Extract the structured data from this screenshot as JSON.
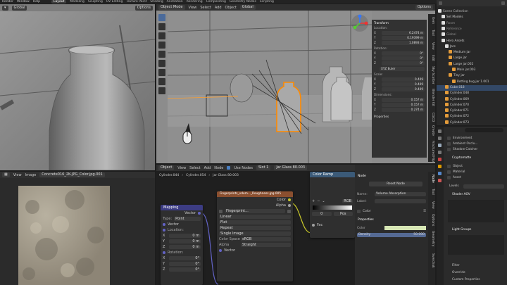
{
  "menu": {
    "items": [
      "Render",
      "Window",
      "Help"
    ],
    "workspace_tabs": [
      "Layout",
      "Modeling",
      "Sculpting",
      "UV Editing",
      "Texture Paint",
      "Shading",
      "Animation",
      "Rendering",
      "Compositing",
      "Geometry Nodes",
      "Scripting"
    ],
    "active_tab": "Layout"
  },
  "left_viewport": {
    "orientation": "Global",
    "options_label": "Options"
  },
  "main_viewport": {
    "mode": "Object Mode",
    "menus": [
      "View",
      "Select",
      "Add",
      "Object"
    ],
    "orientation": "Global",
    "selection_info": "Cylinder.044",
    "options_label": "Options",
    "sidebar_tabs": [
      "Item",
      "Tool",
      "View",
      "Edit",
      "Sky Scatter",
      "Blender Kit",
      "CGCD",
      "Create",
      "Fractured",
      "Flip"
    ]
  },
  "transform": {
    "title": "Transform",
    "location_label": "Location:",
    "location": [
      {
        "axis": "X",
        "value": "6.2474 m"
      },
      {
        "axis": "Y",
        "value": "0.19399 m"
      },
      {
        "axis": "Z",
        "value": "1.0893 m"
      }
    ],
    "rotation_label": "Rotation:",
    "rotation": [
      {
        "axis": "X",
        "value": "0°"
      },
      {
        "axis": "Y",
        "value": "0°"
      },
      {
        "axis": "Z",
        "value": "0°"
      }
    ],
    "rotation_mode": "XYZ Euler",
    "scale_label": "Scale:",
    "scale": [
      {
        "axis": "X",
        "value": "0.409"
      },
      {
        "axis": "Y",
        "value": "0.409"
      },
      {
        "axis": "Z",
        "value": "0.409"
      }
    ],
    "dimensions_label": "Dimensions:",
    "dimensions": [
      {
        "axis": "X",
        "value": "0.157 m"
      },
      {
        "axis": "Y",
        "value": "0.157 m"
      },
      {
        "axis": "Z",
        "value": "0.274 m"
      }
    ],
    "properties_label": "Properties"
  },
  "image_editor": {
    "menus": [
      "View",
      "Image"
    ],
    "image_name": "Concrete016_2K-JPG_Color.jpg.001"
  },
  "node_editor": {
    "type": "Object",
    "menus": [
      "View",
      "Select",
      "Add",
      "Node"
    ],
    "use_nodes_label": "Use Nodes",
    "slot": "Slot 1",
    "material": "Jar Glass 80.003",
    "breadcrumb": [
      "Cylinder.044",
      "Cylinder.054",
      "Jar Glass 80.003"
    ],
    "mapping": {
      "title": "Mapping",
      "output": "Vector",
      "type_label": "Type:",
      "type_value": "Point",
      "input_vector": "Vector",
      "location_label": "Location:",
      "location": [
        {
          "axis": "X",
          "value": "0 m"
        },
        {
          "axis": "Y",
          "value": "0 m"
        },
        {
          "axis": "Z",
          "value": "0 m"
        }
      ],
      "rotation_label": "Rotation:",
      "rotation": [
        {
          "axis": "X",
          "value": "0°"
        },
        {
          "axis": "Y",
          "value": "0°"
        },
        {
          "axis": "Z",
          "value": "0°"
        }
      ]
    },
    "image_texture": {
      "title": "Fingerprints_vdem..._Roughness.jpg.005",
      "outputs": [
        "Color",
        "Alpha"
      ],
      "image_field": "Fingerprint...",
      "interpolation": "Linear",
      "projection": "Flat",
      "extension": "Repeat",
      "source": "Single Image",
      "color_space_label": "Color Space",
      "color_space": "sRGB",
      "alpha_label": "Alpha",
      "alpha": "Straight",
      "input_vector": "Vector"
    },
    "color_ramp": {
      "title": "Color Ramp",
      "mode": "RGB",
      "pos_value": "0",
      "pos_label": "Pos",
      "input": "Fac"
    }
  },
  "node_sidebar": {
    "section_title": "Node",
    "reset_label": "Reset Node",
    "name_label": "Name:",
    "name_value": "Volume Absorption",
    "label_label": "Label:",
    "color_label": "Color",
    "properties_title": "Properties",
    "color_prop_label": "Color",
    "color_swatch": "#d6e6b4",
    "density_label": "Density",
    "density_value": "50.000",
    "tabs": [
      "Node",
      "Tool",
      "View",
      "Options",
      "Geometry",
      "Sverchok"
    ]
  },
  "outliner": {
    "items": [
      {
        "name": "Scene Collection",
        "indent": 0,
        "color": "#bbbbbb"
      },
      {
        "name": "Set Models",
        "indent": 1,
        "color": "#cccccc"
      },
      {
        "name": "Room",
        "indent": 1,
        "color": "#8a8a8a"
      },
      {
        "name": "Reference",
        "indent": 1,
        "color": "#8a8a8a"
      },
      {
        "name": "Global",
        "indent": 1,
        "color": "#8a8a8a"
      },
      {
        "name": "Hero Assets",
        "indent": 1,
        "color": "#cccccc"
      },
      {
        "name": "Jars",
        "indent": 2,
        "color": "#cccccc"
      },
      {
        "name": "Medium jar",
        "indent": 3,
        "color": "#cccccc"
      },
      {
        "name": "Large jar",
        "indent": 3,
        "color": "#cccccc"
      },
      {
        "name": "Large jar.002",
        "indent": 3,
        "color": "#cccccc"
      },
      {
        "name": "Main jar.003",
        "indent": 4,
        "color": "#cccccc"
      },
      {
        "name": "Tiny jar",
        "indent": 3,
        "color": "#cccccc"
      },
      {
        "name": "Rotting bug jar 1.001",
        "indent": 4,
        "color": "#cccccc"
      },
      {
        "name": "Cube.018",
        "indent": 2,
        "color": "#cccccc"
      },
      {
        "name": "Cylinder.048",
        "indent": 2,
        "color": "#cccccc"
      },
      {
        "name": "Cylinder.069",
        "indent": 2,
        "color": "#cccccc"
      },
      {
        "name": "Cylinder.070",
        "indent": 2,
        "color": "#cccccc"
      },
      {
        "name": "Cylinder.071",
        "indent": 2,
        "color": "#cccccc"
      },
      {
        "name": "Cylinder.072",
        "indent": 2,
        "color": "#cccccc"
      },
      {
        "name": "Cylinder.073",
        "indent": 2,
        "color": "#cccccc"
      }
    ]
  },
  "properties_panel": {
    "environment_checks": [
      "Environment",
      "Ambient Occlu...",
      "Shadow Catcher"
    ],
    "cryptomatte_title": "Cryptomatte",
    "cryptomatte_checks": [
      "Object",
      "Material",
      "Asset"
    ],
    "levels_label": "Levels",
    "shader_aov_title": "Shader AOV",
    "light_groups_title": "Light Groups",
    "collapsed_sections": [
      "Filter",
      "Override",
      "Custom Properties"
    ]
  }
}
